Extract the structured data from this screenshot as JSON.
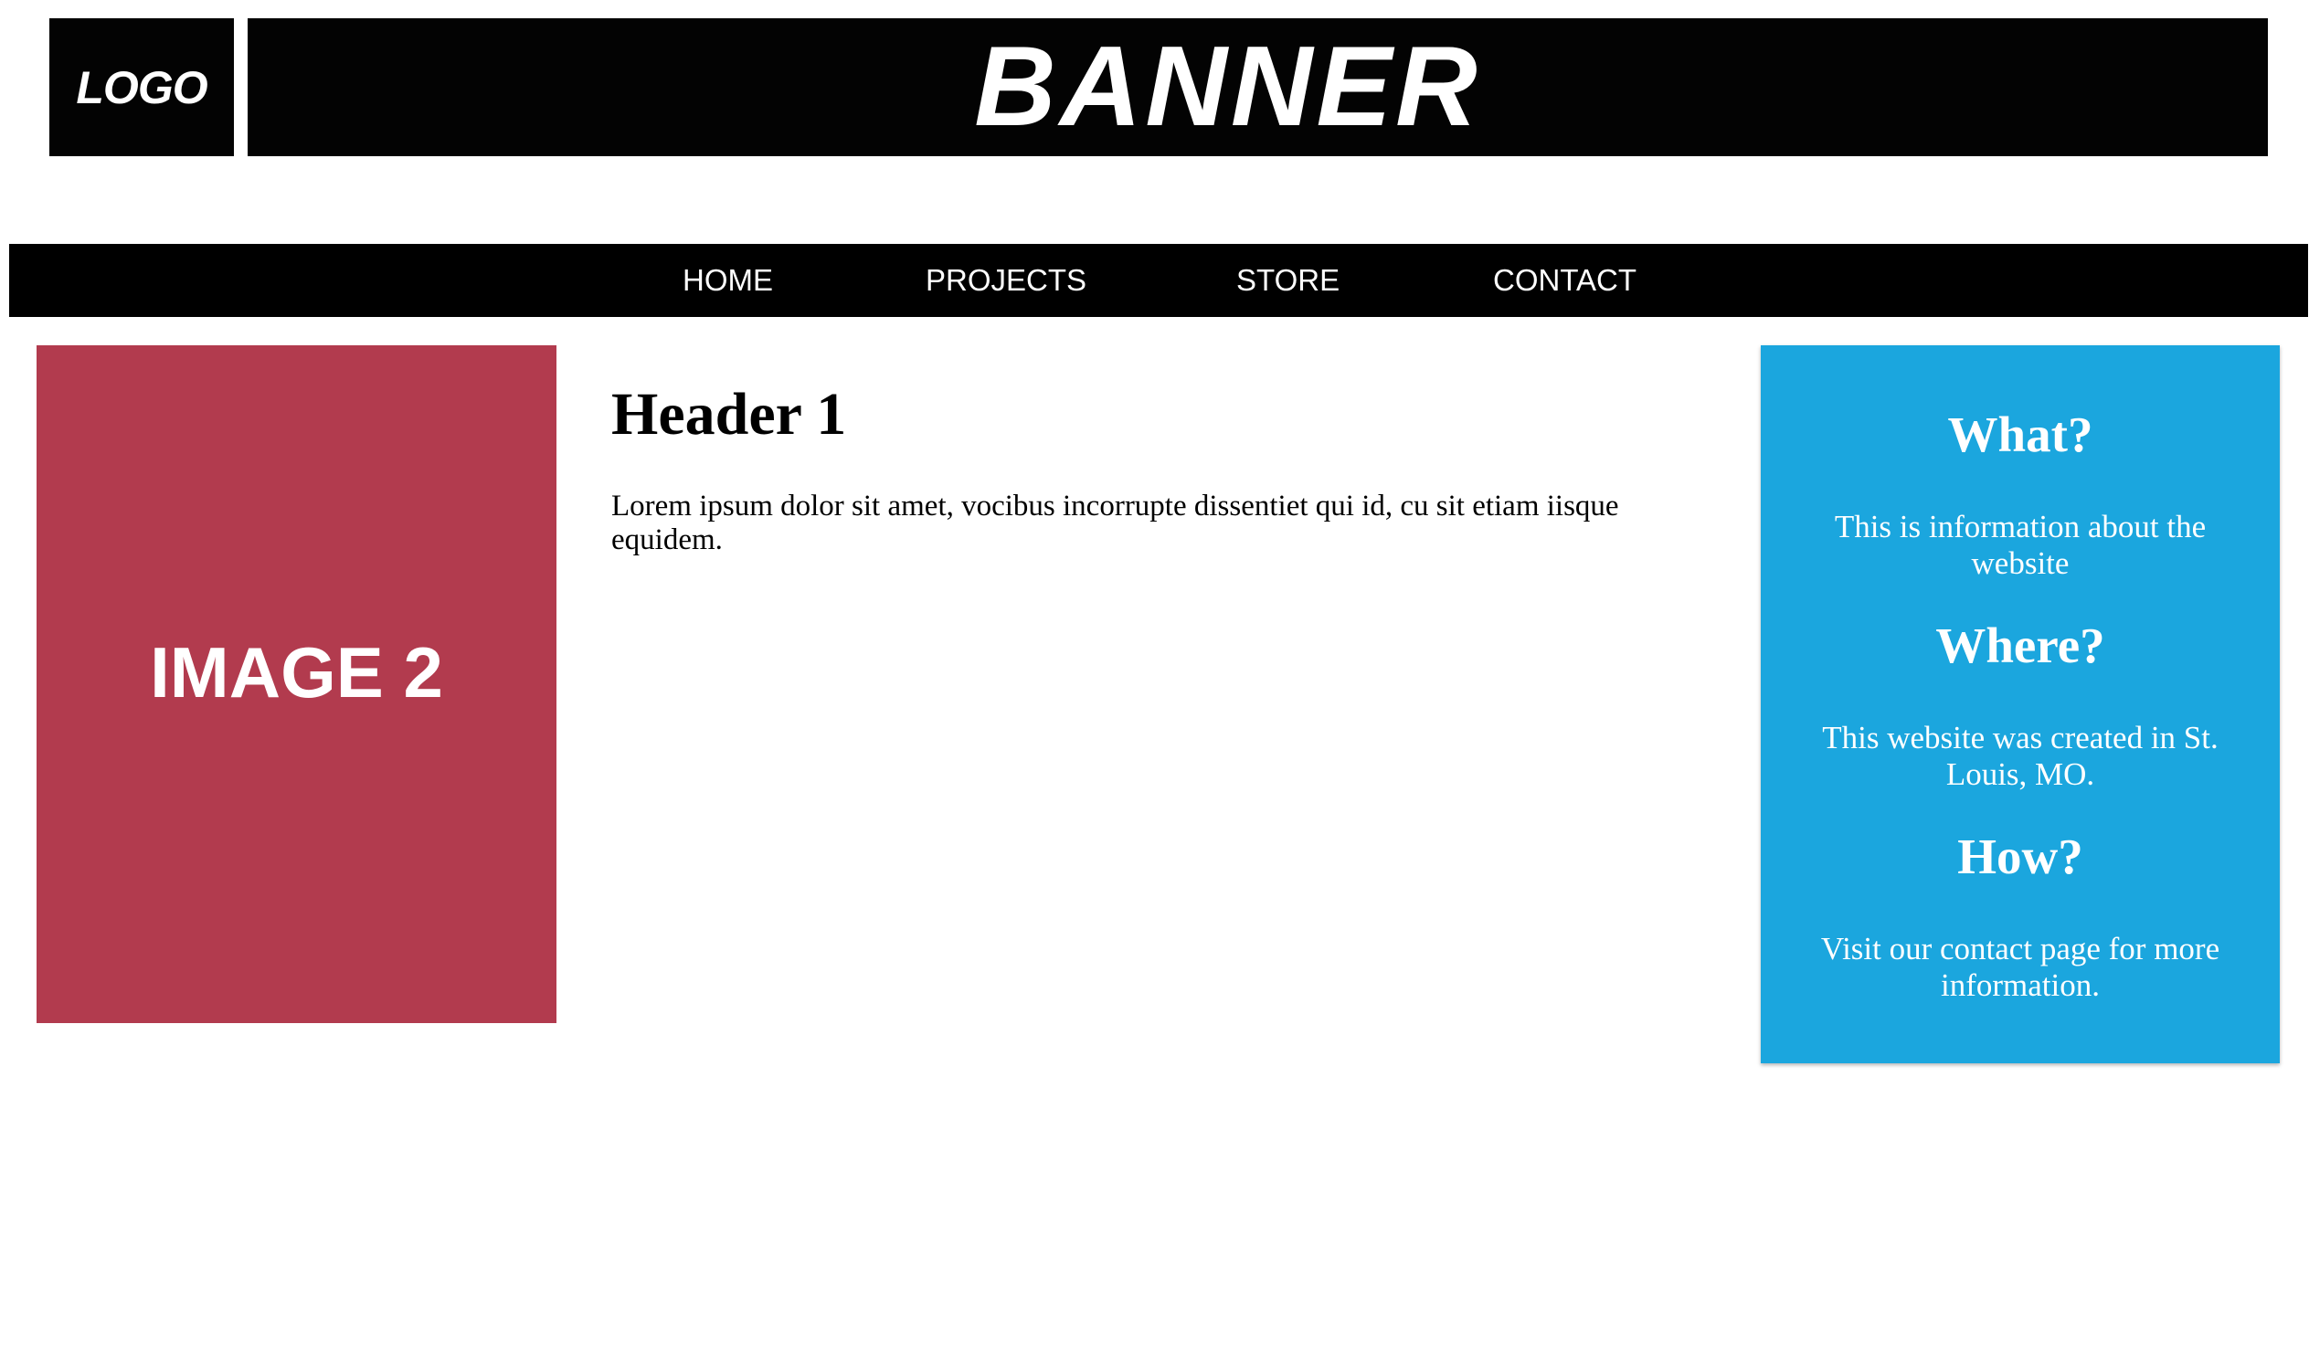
{
  "header": {
    "logo_text": "LOGO",
    "banner_text": "BANNER"
  },
  "nav": {
    "items": [
      {
        "label": "HOME"
      },
      {
        "label": "PROJECTS"
      },
      {
        "label": "STORE"
      },
      {
        "label": "CONTACT"
      }
    ]
  },
  "left_image": {
    "label": "IMAGE 2",
    "color": "#b23b4e"
  },
  "main": {
    "title": "Header 1",
    "body": "Lorem ipsum dolor sit amet, vocibus incorrupte dissentiet qui id, cu sit etiam iisque equidem."
  },
  "sidebar": {
    "color": "#1ba6de",
    "sections": [
      {
        "heading": "What?",
        "text": "This is information about the website"
      },
      {
        "heading": "Where?",
        "text": "This website was created in St. Louis, MO."
      },
      {
        "heading": "How?",
        "text": "Visit our contact page for more information."
      }
    ]
  }
}
